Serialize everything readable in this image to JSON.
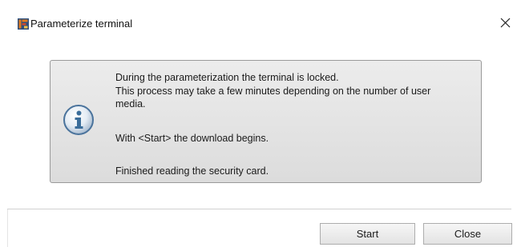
{
  "window": {
    "title": "Parameterize terminal",
    "icon": "app-icon",
    "close_icon": "close-icon"
  },
  "message": {
    "icon": "info-icon",
    "lines": [
      "During the parameterization the terminal is locked.",
      "This process may take a few minutes depending on the number of user",
      "media.",
      "With <Start> the download begins.",
      "Finished reading the security card."
    ]
  },
  "buttons": {
    "start_label": "Start",
    "close_label": "Close"
  },
  "colors": {
    "panel_background": "#e2e2e2",
    "panel_border": "#9a9a9a",
    "info_icon_blue": "#3a6d9a"
  }
}
